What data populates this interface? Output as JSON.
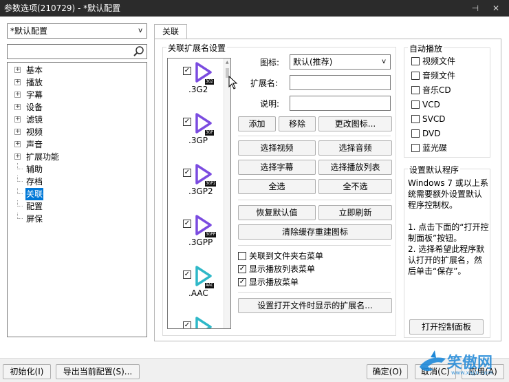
{
  "window": {
    "title": "参数选项(210729) - *默认配置",
    "controls": "⊣ ✕"
  },
  "sidebar": {
    "profile_select": "*默认配置",
    "search_placeholder": "",
    "tree": [
      {
        "label": "基本",
        "expandable": true
      },
      {
        "label": "播放",
        "expandable": true
      },
      {
        "label": "字幕",
        "expandable": true
      },
      {
        "label": "设备",
        "expandable": true
      },
      {
        "label": "滤镜",
        "expandable": true
      },
      {
        "label": "视频",
        "expandable": true
      },
      {
        "label": "声音",
        "expandable": true
      },
      {
        "label": "扩展功能",
        "expandable": true
      },
      {
        "label": "辅助",
        "expandable": false
      },
      {
        "label": "存档",
        "expandable": false
      },
      {
        "label": "关联",
        "expandable": false,
        "selected": true
      },
      {
        "label": "配置",
        "expandable": false
      },
      {
        "label": "屏保",
        "expandable": false
      }
    ]
  },
  "tab": {
    "label": "关联"
  },
  "assoc": {
    "group_title": "关联扩展名设置",
    "extensions": [
      {
        "name": ".3G2",
        "badge": "3G2",
        "checked": true,
        "color": "#7b4ce0"
      },
      {
        "name": ".3GP",
        "badge": "3GP",
        "checked": true,
        "color": "#7b4ce0"
      },
      {
        "name": ".3GP2",
        "badge": "3GP2",
        "checked": true,
        "color": "#7b4ce0"
      },
      {
        "name": ".3GPP",
        "badge": "3GPP",
        "checked": true,
        "color": "#7b4ce0"
      },
      {
        "name": ".AAC",
        "badge": "AAC",
        "checked": true,
        "color": "#2fb8c8"
      },
      {
        "name": "",
        "badge": "",
        "checked": true,
        "color": "#2fb8c8"
      }
    ],
    "icon_label": "图标:",
    "icon_value": "默认(推荐)",
    "ext_label": "扩展名:",
    "desc_label": "说明:",
    "btn_add": "添加",
    "btn_remove": "移除",
    "btn_change_icon": "更改图标...",
    "btn_sel_video": "选择视频",
    "btn_sel_audio": "选择音频",
    "btn_sel_sub": "选择字幕",
    "btn_sel_playlist": "选择播放列表",
    "btn_sel_all": "全选",
    "btn_sel_none": "全不选",
    "btn_restore": "恢复默认值",
    "btn_refresh": "立即刷新",
    "btn_clear_cache": "清除缓存重建图标",
    "opt_folder_menu": {
      "label": "关联到文件夹右菜单",
      "checked": false
    },
    "opt_playlist_menu": {
      "label": "显示播放列表菜单",
      "checked": true
    },
    "opt_play_menu": {
      "label": "显示播放菜单",
      "checked": true
    },
    "btn_set_ext_display": "设置打开文件时显示的扩展名..."
  },
  "autoplay": {
    "title": "自动播放",
    "items": [
      {
        "label": "视频文件",
        "checked": false
      },
      {
        "label": "音频文件",
        "checked": false
      },
      {
        "label": "音乐CD",
        "checked": false
      },
      {
        "label": "VCD",
        "checked": false
      },
      {
        "label": "SVCD",
        "checked": false
      },
      {
        "label": "DVD",
        "checked": false
      },
      {
        "label": "蓝光碟",
        "checked": false
      }
    ]
  },
  "defaultprog": {
    "title": "设置默认程序",
    "text": "Windows 7 或以上系统需要额外设置默认程序控制权。\n\n1. 点击下面的“打开控制面板”按钮。\n2. 选择希望此程序默认打开的扩展名，然后单击“保存”。",
    "btn_open_cp": "打开控制面板"
  },
  "footer": {
    "btn_init": "初始化(I)",
    "btn_export": "导出当前配置(S)...",
    "btn_ok": "确定(O)",
    "btn_cancel": "取消(C)",
    "btn_apply": "应用(A)"
  },
  "watermark": {
    "text": "笑傲网",
    "url": "www.xajjn.com"
  }
}
